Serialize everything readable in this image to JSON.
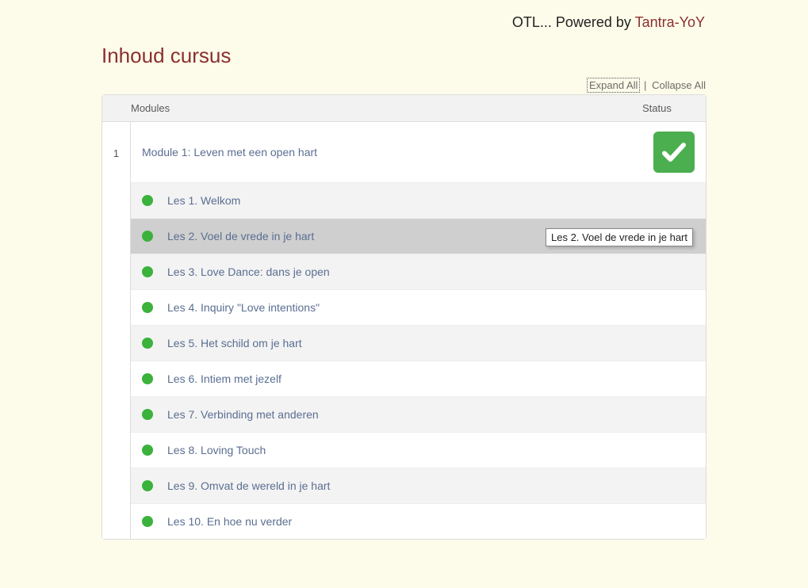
{
  "header": {
    "prefix": "OTL... Powered by ",
    "brand": "Tantra-YoY"
  },
  "page_title": "Inhoud cursus",
  "controls": {
    "expand": "Expand All",
    "collapse": "Collapse All"
  },
  "table_header": {
    "modules": "Modules",
    "status": "Status"
  },
  "module": {
    "number": "1",
    "title": "Module 1: Leven met een open hart",
    "completed": true,
    "lessons": [
      {
        "title": "Les 1. Welkom",
        "hovered": false
      },
      {
        "title": "Les 2. Voel de vrede in je hart",
        "hovered": true
      },
      {
        "title": "Les 3. Love Dance: dans je open",
        "hovered": false
      },
      {
        "title": "Les 4. Inquiry \"Love intentions\"",
        "hovered": false
      },
      {
        "title": "Les 5. Het schild om je hart",
        "hovered": false
      },
      {
        "title": "Les 6. Intiem met jezelf",
        "hovered": false
      },
      {
        "title": "Les 7. Verbinding met anderen",
        "hovered": false
      },
      {
        "title": "Les 8. Loving Touch",
        "hovered": false
      },
      {
        "title": "Les 9. Omvat de wereld in je hart",
        "hovered": false
      },
      {
        "title": "Les 10. En hoe nu verder",
        "hovered": false
      }
    ]
  },
  "tooltip": "Les 2. Voel de vrede in je hart"
}
